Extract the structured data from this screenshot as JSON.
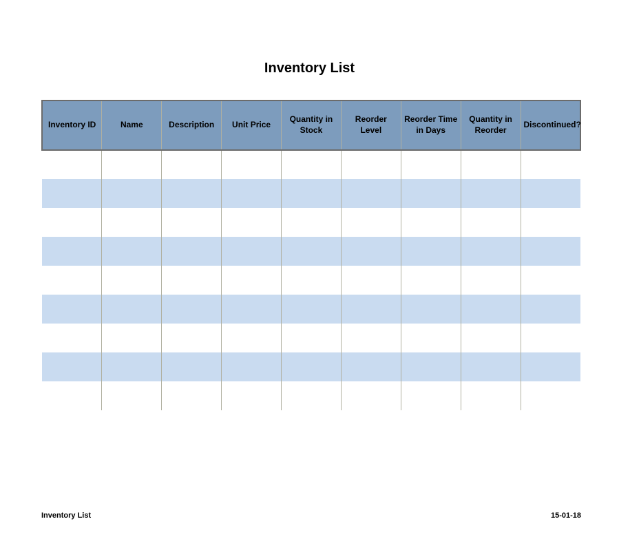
{
  "title": "Inventory List",
  "footer": {
    "left": "Inventory List",
    "right": "15-01-18"
  },
  "columns": [
    "Inventory ID",
    "Name",
    "Description",
    "Unit Price",
    "Quantity in Stock",
    "Reorder Level",
    "Reorder Time in Days",
    "Quantity in Reorder",
    "Discontinued?"
  ],
  "rows": [
    [
      "",
      "",
      "",
      "",
      "",
      "",
      "",
      "",
      ""
    ],
    [
      "",
      "",
      "",
      "",
      "",
      "",
      "",
      "",
      ""
    ],
    [
      "",
      "",
      "",
      "",
      "",
      "",
      "",
      "",
      ""
    ],
    [
      "",
      "",
      "",
      "",
      "",
      "",
      "",
      "",
      ""
    ],
    [
      "",
      "",
      "",
      "",
      "",
      "",
      "",
      "",
      ""
    ],
    [
      "",
      "",
      "",
      "",
      "",
      "",
      "",
      "",
      ""
    ],
    [
      "",
      "",
      "",
      "",
      "",
      "",
      "",
      "",
      ""
    ],
    [
      "",
      "",
      "",
      "",
      "",
      "",
      "",
      "",
      ""
    ],
    [
      "",
      "",
      "",
      "",
      "",
      "",
      "",
      "",
      ""
    ]
  ]
}
